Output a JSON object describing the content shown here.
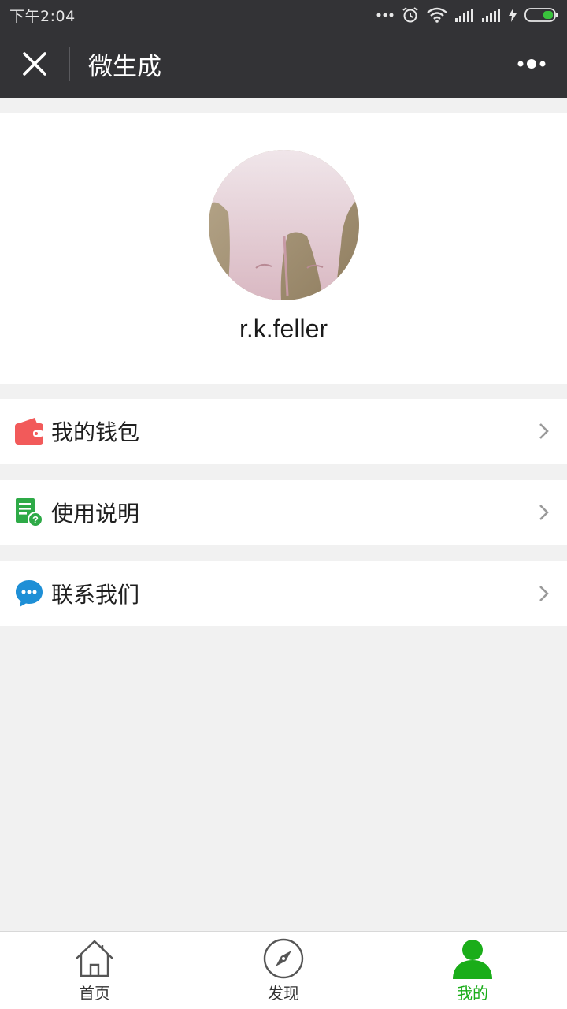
{
  "status_bar": {
    "time": "下午2:04"
  },
  "nav": {
    "title": "微生成"
  },
  "profile": {
    "username": "r.k.feller"
  },
  "menu": [
    {
      "label": "我的钱包",
      "icon": "wallet-icon",
      "color": "#f25a5a"
    },
    {
      "label": "使用说明",
      "icon": "guide-doc-icon",
      "color": "#2eaa47"
    },
    {
      "label": "联系我们",
      "icon": "chat-bubble-icon",
      "color": "#1e8fd6"
    }
  ],
  "tabs": [
    {
      "label": "首页",
      "icon": "home-icon",
      "active": false
    },
    {
      "label": "发现",
      "icon": "compass-icon",
      "active": false
    },
    {
      "label": "我的",
      "icon": "user-icon",
      "active": true
    }
  ],
  "colors": {
    "header_bg": "#333336",
    "accent_green": "#1aad19",
    "page_bg": "#f1f1f1"
  }
}
